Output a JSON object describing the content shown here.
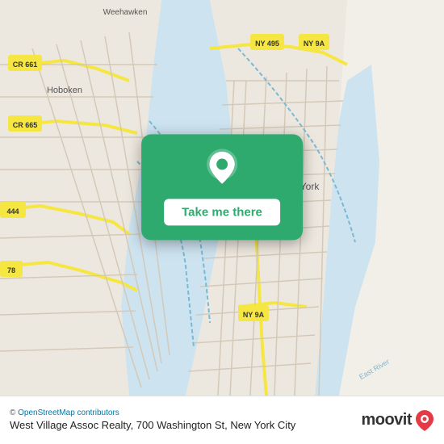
{
  "map": {
    "background_color": "#e8e0d8",
    "alt": "Map of New York City area including Hoboken, Weehawken, and Manhattan"
  },
  "card": {
    "button_label": "Take me there",
    "pin_icon": "location-pin"
  },
  "footer": {
    "osm_credit": "© OpenStreetMap contributors",
    "location_name": "West Village Assoc Realty, 700 Washington St, New\nYork City",
    "logo_text": "moovit"
  }
}
